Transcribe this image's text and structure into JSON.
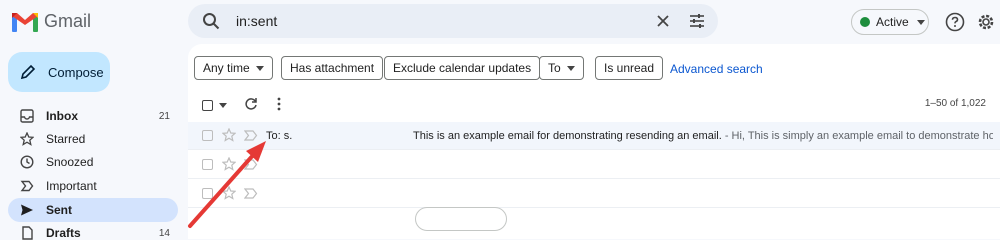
{
  "app": {
    "name": "Gmail"
  },
  "search": {
    "query": "in:sent"
  },
  "status": {
    "label": "Active",
    "color": "#1e8e3e"
  },
  "compose": {
    "label": "Compose"
  },
  "sidebar": {
    "items": [
      {
        "label": "Inbox",
        "count": "21",
        "icon": "inbox-icon"
      },
      {
        "label": "Starred",
        "count": "",
        "icon": "star-icon"
      },
      {
        "label": "Snoozed",
        "count": "",
        "icon": "clock-icon"
      },
      {
        "label": "Important",
        "count": "",
        "icon": "important-icon"
      },
      {
        "label": "Sent",
        "count": "",
        "icon": "send-icon"
      },
      {
        "label": "Drafts",
        "count": "14",
        "icon": "draft-icon"
      }
    ]
  },
  "filters": {
    "chips": [
      "Any time",
      "Has attachment",
      "Exclude calendar updates",
      "To",
      "Is unread"
    ],
    "advanced_link": "Advanced search"
  },
  "toolbar": {
    "pager": "1–50 of 1,022"
  },
  "emails": [
    {
      "sender": "To: s.",
      "subject": "This is an example email for demonstrating resending an email.",
      "snippet": " - Hi, This is simply an example email to demonstrate ho..."
    }
  ],
  "colors": {
    "accent": "#0b57d0",
    "compose_bg": "#c2e7ff",
    "active_nav": "#d3e3fd",
    "annotation_arrow": "#e53935"
  }
}
